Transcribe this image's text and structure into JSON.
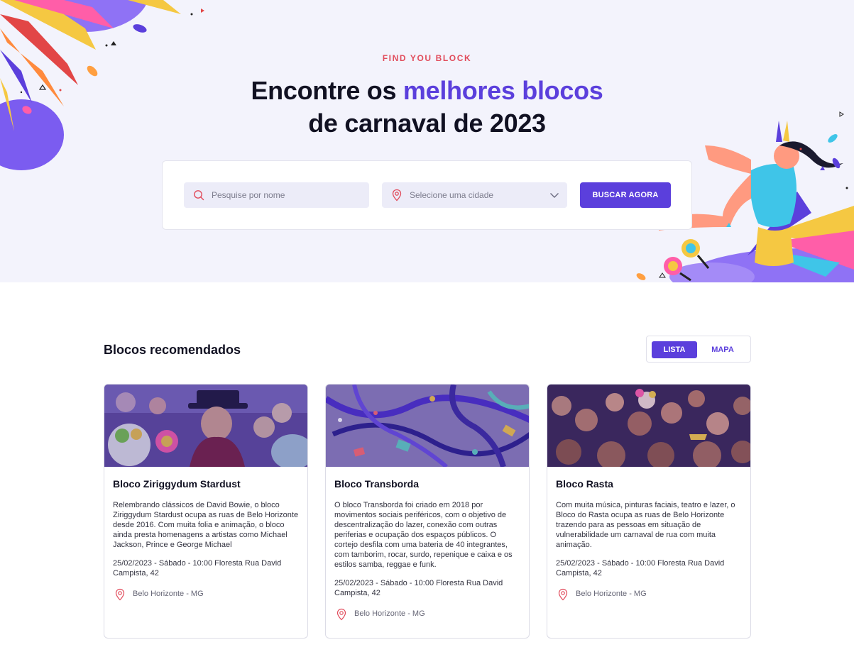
{
  "hero": {
    "eyebrow": "FIND YOU BLOCK",
    "title_part1": "Encontre os ",
    "title_accent": "melhores blocos",
    "title_part2": "de carnaval de 2023"
  },
  "search": {
    "name_placeholder": "Pesquise por nome",
    "city_placeholder": "Selecione uma cidade",
    "button_label": "BUSCAR AGORA"
  },
  "section": {
    "title": "Blocos recomendados",
    "view_list": "LISTA",
    "view_map": "MAPA",
    "active_view": "LISTA"
  },
  "cards": [
    {
      "name": "Bloco Ziriggydum Stardust",
      "description": "Relembrando clássicos de David Bowie, o bloco Ziriggydum Stardust ocupa as ruas de Belo Horizonte desde 2016. Com muita folia e animação, o bloco ainda presta homenagens a artistas como Michael Jackson, Prince e George Michael",
      "date": "25/02/2023 - Sábado - 10:00 Floresta Rua David Campista, 42",
      "location": "Belo Horizonte - MG"
    },
    {
      "name": "Bloco Transborda",
      "description": "O bloco Transborda foi criado em 2018 por movimentos sociais periféricos, com o objetivo de descentralização do lazer, conexão com outras periferias e ocupação dos espaços públicos. O cortejo desfila com uma bateria de 40 integrantes, com tamborim, rocar, surdo, repenique e caixa e os estilos samba, reggae e funk.",
      "date": "25/02/2023 - Sábado - 10:00 Floresta Rua David Campista, 42",
      "location": "Belo Horizonte - MG"
    },
    {
      "name": "Bloco Rasta",
      "description": "Com muita música, pinturas faciais, teatro e lazer, o Bloco do Rasta ocupa as ruas de Belo Horizonte trazendo para as pessoas em situação de vulnerabilidade um carnaval de rua com muita animação.",
      "date": "25/02/2023 - Sábado - 10:00 Floresta Rua David Campista, 42",
      "location": "Belo Horizonte - MG"
    }
  ],
  "colors": {
    "accent": "#5b3fdc",
    "eyebrow": "#e14c5c",
    "hero_bg": "#f3f3fc",
    "pin": "#e14c5c"
  },
  "icons": {
    "search": "search-icon",
    "city": "map-pin-icon",
    "dropdown": "chevron-down-icon",
    "location": "map-pin-icon"
  }
}
